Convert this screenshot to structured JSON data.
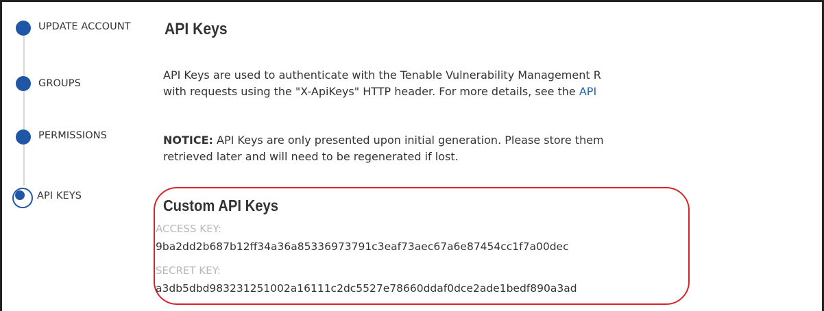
{
  "sidebar": {
    "steps": [
      {
        "label": "UPDATE ACCOUNT"
      },
      {
        "label": "GROUPS"
      },
      {
        "label": "PERMISSIONS"
      },
      {
        "label": "API KEYS"
      }
    ]
  },
  "main": {
    "title": "API Keys",
    "description_line1": "API Keys are used to authenticate with the Tenable Vulnerability Management R",
    "description_line2_prefix": "with requests using the \"X-ApiKeys\" HTTP header. For more details, see the ",
    "description_link": "API",
    "notice_label": "NOTICE:",
    "notice_line1": " API Keys are only presented upon initial generation. Please store them",
    "notice_line2": "retrieved later and will need to be regenerated if lost.",
    "custom_keys": {
      "title": "Custom API Keys",
      "access_key_label": "ACCESS KEY:",
      "access_key_value": "9ba2dd2b687b12ff34a36a85336973791c3eaf73aec67a6e87454cc1f7a00dec",
      "secret_key_label": "SECRET KEY:",
      "secret_key_value": "a3db5dbd983231251002a16111c2dc5527e78660ddaf0dce2ade1bedf890a3ad"
    }
  },
  "colors": {
    "step_dot": "#1f56a6",
    "link": "#1f63b8",
    "highlight_border": "#d9232a",
    "label_gray": "#b8b8b8"
  }
}
